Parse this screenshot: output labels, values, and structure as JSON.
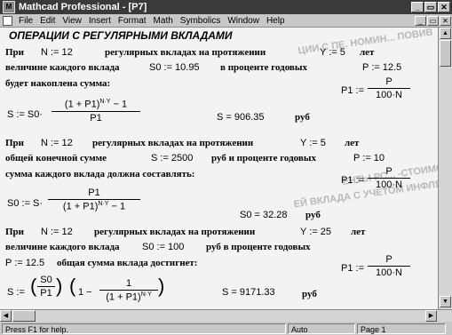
{
  "window": {
    "title": "Mathcad Professional - [P7]",
    "app_icon": "M",
    "buttons": [
      "_",
      "▭",
      "✕"
    ]
  },
  "menu": {
    "items": [
      "File",
      "Edit",
      "View",
      "Insert",
      "Format",
      "Math",
      "Symbolics",
      "Window",
      "Help"
    ],
    "doc_buttons": [
      "_",
      "▭",
      "✕"
    ]
  },
  "worksheet": {
    "heading": "ОПЕРАЦИИ С РЕГУЛЯРНЫМИ ВКЛАДАМИ",
    "ghost_texts": [
      "ЦИИ С ПЕ. НОМИН... ПОВИВ",
      "ЕНТЫ РС...  -СТОИМО",
      "ЕЙ ВКЛАДА С УЧЕТОМ ИНФЛЯЦИИ"
    ],
    "sec1": {
      "line1_pre": "При",
      "N_def": "N := 12",
      "line1_mid": "регулярных вкладах на протяжении",
      "Y_def": "Y := 5",
      "line1_post": "лет",
      "line2_pre": "величине каждого вклада",
      "S0_def": "S0 := 10.95",
      "line2_mid": "в проценте годовых",
      "P_def": "P := 12.5",
      "line3": "будет накоплена сумма:",
      "P1_lhs": "P1 :=",
      "P1_num": "P",
      "P1_den": "100·N",
      "S_lhs": "S := S0·",
      "S_num": "(1 + P1)",
      "S_exp": "N·Y",
      "S_num_tail": " − 1",
      "S_den": "P1",
      "result": "S = 906.35",
      "unit": "руб"
    },
    "sec2": {
      "line1_pre": "При",
      "N_def": "N := 12",
      "line1_mid": "регулярных вкладах на протяжении",
      "Y_def": "Y := 5",
      "line1_post": "лет",
      "line2_pre": "общей конечной сумме",
      "S_def": "S := 2500",
      "line2_mid": "руб и проценте годовых",
      "P_def": "P := 10",
      "line3": "сумма каждого вклада должна составлять:",
      "P1_lhs": "P1 :=",
      "P1_num": "P",
      "P1_den": "100·N",
      "S0_lhs": "S0 := S·",
      "S0_num": "P1",
      "S0_den": "(1 + P1)",
      "S0_exp": "N·Y",
      "S0_den_tail": " − 1",
      "result": "S0 = 32.28",
      "unit": "руб"
    },
    "sec3": {
      "line1_pre": "При",
      "N_def": "N := 12",
      "line1_mid": "регулярных вкладах на протяжении",
      "Y_def": "Y := 25",
      "line1_post": "лет",
      "line2_pre": "величине каждого вклада",
      "S0_def": "S0 := 100",
      "line2_mid": "руб в проценте годовых",
      "P_def": "P := 12.5",
      "line3_post": "общая сумма вклада достигнет:",
      "P1_lhs": "P1 :=",
      "P1_num": "P",
      "P1_den": "100·N",
      "S_lhs": "S :=",
      "S_paren_num": "S0",
      "S_paren_den": "P1",
      "S_one": "1 −",
      "S_inner_num": "1",
      "S_inner_den": "(1 + P1)",
      "S_inner_exp": "N·Y",
      "result": "S = 9171.33",
      "unit": "руб"
    }
  },
  "status": {
    "help": "Press F1 for help.",
    "mode": "Auto",
    "page": "Page 1"
  }
}
